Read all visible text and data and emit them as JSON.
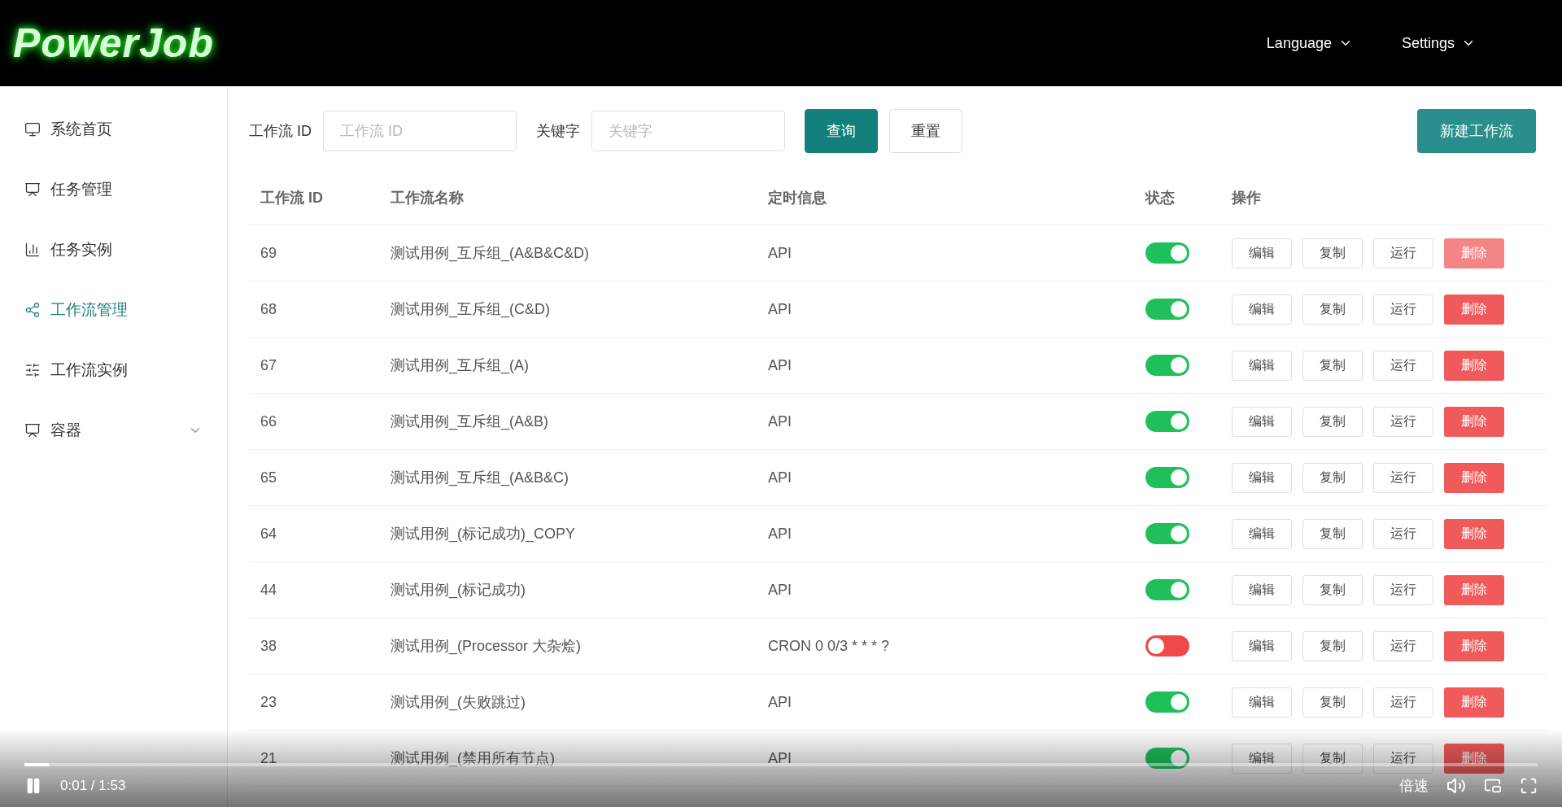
{
  "header": {
    "logo": "PowerJob",
    "menus": [
      {
        "label": "Language"
      },
      {
        "label": "Settings"
      }
    ]
  },
  "sidebar": {
    "items": [
      {
        "label": "系统首页",
        "selected": false,
        "expandable": false
      },
      {
        "label": "任务管理",
        "selected": false,
        "expandable": false
      },
      {
        "label": "任务实例",
        "selected": false,
        "expandable": false
      },
      {
        "label": "工作流管理",
        "selected": true,
        "expandable": false
      },
      {
        "label": "工作流实例",
        "selected": false,
        "expandable": false
      },
      {
        "label": "容器",
        "selected": false,
        "expandable": true
      }
    ]
  },
  "filters": [
    {
      "label": "工作流 ID",
      "placeholder": "工作流 ID"
    },
    {
      "label": "关键字",
      "placeholder": "关键字"
    }
  ],
  "filter_buttons": [
    {
      "label": "查询",
      "kind": "primary"
    },
    {
      "label": "重置",
      "kind": "default"
    }
  ],
  "create_button": "新建工作流",
  "table": {
    "columns": [
      "工作流 ID",
      "工作流名称",
      "定时信息",
      "状态",
      "操作"
    ],
    "rows": [
      {
        "id": "69",
        "name": "测试用例_互斥组_(A&B&C&D)",
        "schedule": "API",
        "on": true,
        "actions": [
          "编辑",
          "复制",
          "运行",
          "删除"
        ],
        "delete_hovered": true
      },
      {
        "id": "68",
        "name": "测试用例_互斥组_(C&D)",
        "schedule": "API",
        "on": true,
        "actions": [
          "编辑",
          "复制",
          "运行",
          "删除"
        ],
        "delete_hovered": false
      },
      {
        "id": "67",
        "name": "测试用例_互斥组_(A)",
        "schedule": "API",
        "on": true,
        "actions": [
          "编辑",
          "复制",
          "运行",
          "删除"
        ],
        "delete_hovered": false
      },
      {
        "id": "66",
        "name": "测试用例_互斥组_(A&B)",
        "schedule": "API",
        "on": true,
        "actions": [
          "编辑",
          "复制",
          "运行",
          "删除"
        ],
        "delete_hovered": false
      },
      {
        "id": "65",
        "name": "测试用例_互斥组_(A&B&C)",
        "schedule": "API",
        "on": true,
        "actions": [
          "编辑",
          "复制",
          "运行",
          "删除"
        ],
        "delete_hovered": false
      },
      {
        "id": "64",
        "name": "测试用例_(标记成功)_COPY",
        "schedule": "API",
        "on": true,
        "actions": [
          "编辑",
          "复制",
          "运行",
          "删除"
        ],
        "delete_hovered": false
      },
      {
        "id": "44",
        "name": "测试用例_(标记成功)",
        "schedule": "API",
        "on": true,
        "actions": [
          "编辑",
          "复制",
          "运行",
          "删除"
        ],
        "delete_hovered": false
      },
      {
        "id": "38",
        "name": "测试用例_(Processor 大杂烩)",
        "schedule": "CRON 0 0/3 * * * ?",
        "on": false,
        "actions": [
          "编辑",
          "复制",
          "运行",
          "删除"
        ],
        "delete_hovered": false
      },
      {
        "id": "23",
        "name": "测试用例_(失败跳过)",
        "schedule": "API",
        "on": true,
        "actions": [
          "编辑",
          "复制",
          "运行",
          "删除"
        ],
        "delete_hovered": false
      },
      {
        "id": "21",
        "name": "测试用例_(禁用所有节点)",
        "schedule": "API",
        "on": true,
        "actions": [
          "编辑",
          "复制",
          "运行",
          "删除"
        ],
        "delete_hovered": false
      }
    ]
  },
  "player": {
    "playing": true,
    "time": "0:01 / 1:53",
    "level": 0.016,
    "speed": "倍速"
  }
}
